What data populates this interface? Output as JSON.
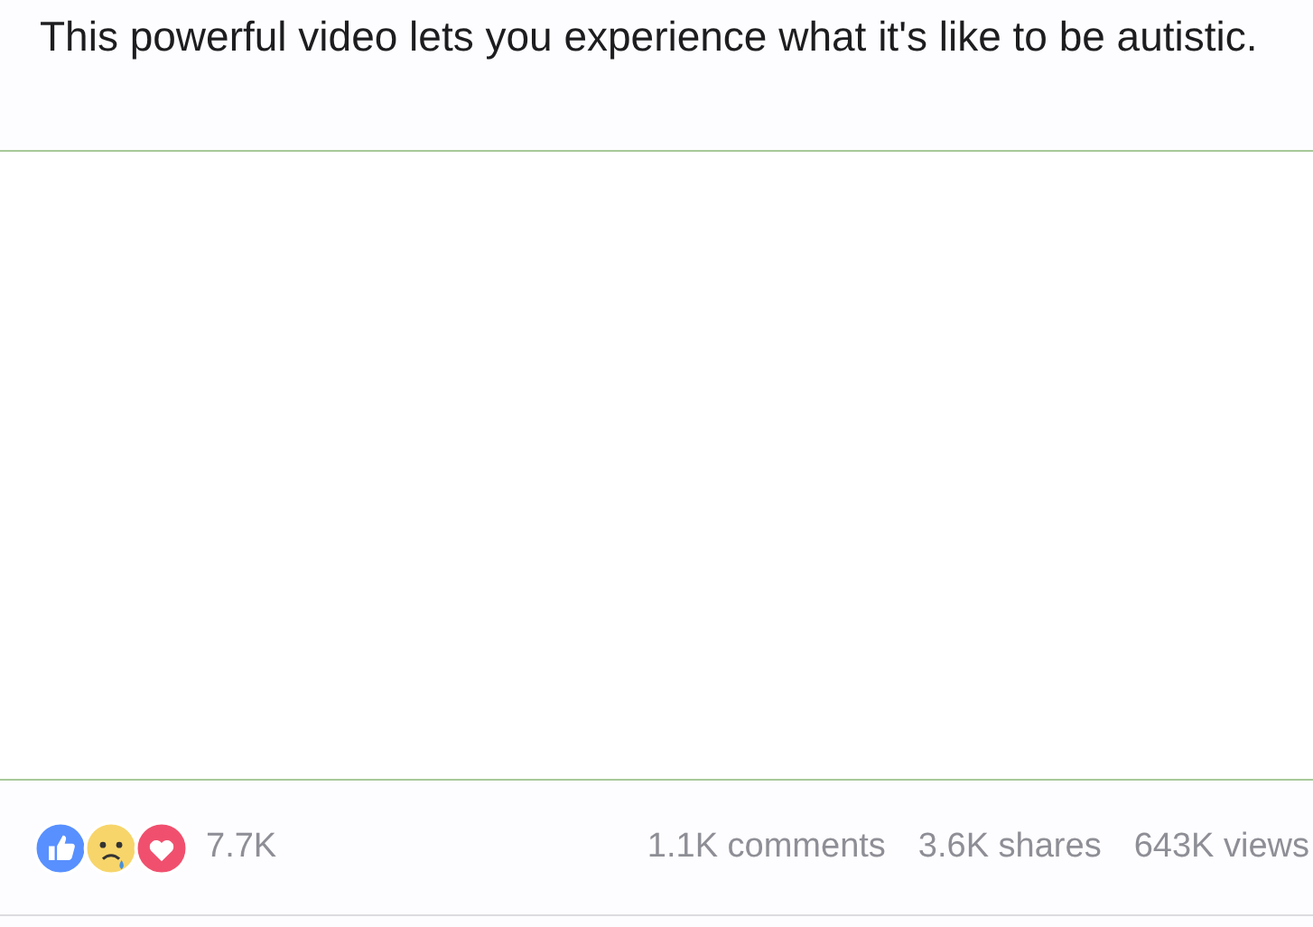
{
  "post": {
    "caption": "This powerful video lets you experience what it's like to be autistic."
  },
  "reactions": [
    {
      "kind": "like"
    },
    {
      "kind": "sad"
    },
    {
      "kind": "love"
    }
  ],
  "reaction_count": "7.7K",
  "stats": [
    "1.1K comments",
    "3.6K shares",
    "643K views"
  ]
}
